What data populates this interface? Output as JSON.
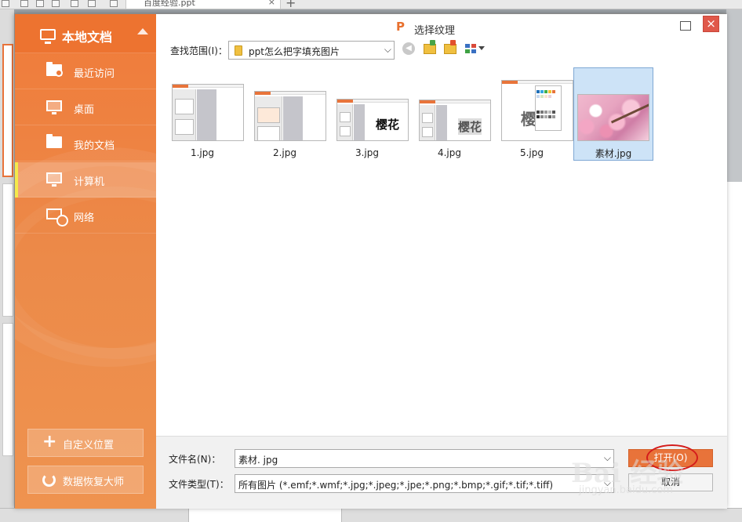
{
  "background": {
    "doc_tab": "百度经验.ppt",
    "doc_tab_close": "×",
    "new_tab": "+"
  },
  "sidebar": {
    "title": "本地文档",
    "items": [
      {
        "label": "最近访问",
        "icon": "recent-folder-icon"
      },
      {
        "label": "桌面",
        "icon": "desktop-icon"
      },
      {
        "label": "我的文档",
        "icon": "documents-folder-icon"
      },
      {
        "label": "计算机",
        "icon": "computer-icon",
        "active": true
      },
      {
        "label": "网络",
        "icon": "network-icon"
      }
    ],
    "custom_location": "自定义位置",
    "recovery": "数据恢复大师"
  },
  "dialog": {
    "logo": "P",
    "title": "选择纹理",
    "close": "×",
    "look_in_label": "查找范围(I)：",
    "look_in_value": "ppt怎么把字填充图片",
    "dropdown_arrow": "⌵",
    "files": [
      {
        "name": "1.jpg"
      },
      {
        "name": "2.jpg"
      },
      {
        "name": "3.jpg",
        "thumb_text": "樱花"
      },
      {
        "name": "4.jpg",
        "thumb_text": "樱花"
      },
      {
        "name": "5.jpg",
        "thumb_text": "樱花"
      },
      {
        "name": "素材.jpg",
        "selected": true
      }
    ],
    "filename_label": "文件名(N)：",
    "filename_value": "素材. jpg",
    "filetype_label": "文件类型(T)：",
    "filetype_value": "所有图片 (*.emf;*.wmf;*.jpg;*.jpeg;*.jpe;*.png;*.bmp;*.gif;*.tif;*.tiff)",
    "open_button": "打开(O)",
    "cancel_button": "取消"
  },
  "watermark": {
    "main": "Bai 经验",
    "url": "jingyan.baidu.com"
  },
  "colors": {
    "accent": "#e8733a",
    "sidebar": "#ef8a4a",
    "close": "#e0584a",
    "selection": "#cde3f7",
    "highlight_circle": "#d41c1c"
  }
}
